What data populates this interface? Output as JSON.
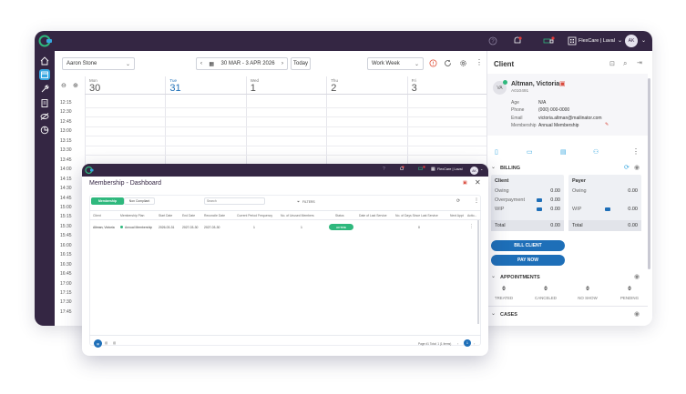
{
  "topbar": {
    "org_label": "FlexCare | Laval",
    "user_initials": "AK",
    "help_icon": "help-circle-icon",
    "bell_icon": "bell-icon",
    "truck_icon": "truck-icon",
    "building_icon": "building-icon"
  },
  "sidebar": {
    "items": [
      {
        "icon": "home-icon"
      },
      {
        "icon": "calendar-icon",
        "active": true
      },
      {
        "icon": "wrench-icon"
      },
      {
        "icon": "clipboard-icon"
      },
      {
        "icon": "visibility-off-icon"
      },
      {
        "icon": "chart-pie-icon"
      }
    ]
  },
  "calendar": {
    "resource": "Aaron Stone",
    "date_range": "30 MAR - 3 APR 2026",
    "today_label": "Today",
    "view_label": "Work Week",
    "days": [
      {
        "name": "Mon",
        "num": "30"
      },
      {
        "name": "Tue",
        "num": "31",
        "active": true
      },
      {
        "name": "Wed",
        "num": "1"
      },
      {
        "name": "Thu",
        "num": "2"
      },
      {
        "name": "Fri",
        "num": "3"
      }
    ],
    "times": [
      "12:15",
      "12:30",
      "12:45",
      "13:00",
      "13:15",
      "13:30",
      "13:45",
      "14:00",
      "14:15",
      "14:30",
      "14:45",
      "15:00",
      "15:15",
      "15:30",
      "15:45",
      "16:00",
      "16:15",
      "16:30",
      "16:45",
      "17:00",
      "17:15",
      "17:30",
      "17:45"
    ]
  },
  "client": {
    "panel_title": "Client",
    "avatar_initials": "VA",
    "name": "Altman, Victoria",
    "id": "A010491",
    "fields": [
      {
        "label": "Age",
        "value": "N/A"
      },
      {
        "label": "Phone",
        "value": "(000) 000-0000"
      },
      {
        "label": "Email",
        "value": "victoria.altman@mailinator.com"
      },
      {
        "label": "Membership",
        "value": "Annual Membership"
      }
    ],
    "billing": {
      "title": "BILLING",
      "client": {
        "title": "Client",
        "rows": [
          {
            "label": "Owing",
            "value": "0.00"
          },
          {
            "label": "Overpayment",
            "value": "0.00"
          },
          {
            "label": "WIP",
            "value": "0.00"
          }
        ],
        "total_label": "Total",
        "total_value": "0.00"
      },
      "payer": {
        "title": "Payer",
        "rows": [
          {
            "label": "Owing",
            "value": "0.00"
          },
          {
            "label": "WIP",
            "value": "0.00"
          }
        ],
        "total_label": "Total",
        "total_value": "0.00"
      },
      "bill_client": "BILL CLIENT",
      "pay_now": "PAY NOW"
    },
    "appointments": {
      "title": "APPOINTMENTS",
      "stats": [
        {
          "value": "0",
          "label": "TREATED"
        },
        {
          "value": "0",
          "label": "CANCELED"
        },
        {
          "value": "0",
          "label": "NO SHOW"
        },
        {
          "value": "0",
          "label": "PENDING"
        }
      ]
    },
    "cases": {
      "title": "CASES"
    }
  },
  "front": {
    "topbar": {
      "org_label": "FlexCare | Laval",
      "user_initials": "AK"
    },
    "title": "Membership - Dashboard",
    "tabs": [
      "Membership",
      "Non Compliant"
    ],
    "search_placeholder": "Search",
    "filters_label": "FILTERS",
    "columns": [
      "Client",
      "Membership Plan",
      "Start Date",
      "End Date",
      "Reconcile Date",
      "Current Period Frequency",
      "No. of Unused Members",
      "Status",
      "Date of Last Service",
      "No. of Days Since Last Service",
      "Next Appt",
      "Actio..."
    ],
    "rows": [
      {
        "client": "Altman, Victoria",
        "plan": "Annual Membership",
        "start": "2026-03-31",
        "end": "2027-03-30",
        "reconcile": "2027-03-30",
        "frequency": "1",
        "unused": "1",
        "status": "ACTIVE",
        "last_service": "",
        "days_since": "0",
        "next_appt": ""
      }
    ],
    "footer": {
      "page_info": "Page #1 Total: 1 (1 items)",
      "page": "1"
    }
  },
  "colors": {
    "nav": "#342643",
    "accent": "#37a7e0",
    "primary_button": "#1e6fb8",
    "active_badge": "#2fb87d"
  }
}
